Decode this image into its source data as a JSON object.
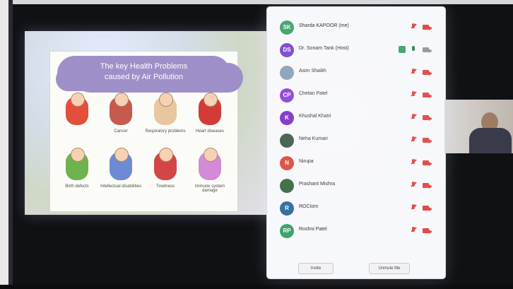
{
  "slide": {
    "title": "The key Health Problems\ncaused by Air Pollution",
    "problems": [
      {
        "label": ""
      },
      {
        "label": "Cancer"
      },
      {
        "label": "Respiratory problems"
      },
      {
        "label": "Heart diseases"
      },
      {
        "label": "Birth defects"
      },
      {
        "label": "Intellectual disabilities"
      },
      {
        "label": "Tiredness"
      },
      {
        "label": "Immune system damage"
      }
    ]
  },
  "participants": [
    {
      "initials": "SK",
      "name": "Sharda KAPOOR (me)",
      "color": "#43a36a",
      "mic": "muted",
      "cam": "off"
    },
    {
      "initials": "DS",
      "name": "Dr. Sonam Tank (Host)",
      "color": "#7c47c9",
      "mic": "on",
      "cam": "on",
      "host": true
    },
    {
      "initials": "",
      "name": "Asim Shaikh",
      "color": "#8aa0b4",
      "mic": "muted",
      "cam": "off"
    },
    {
      "initials": "CP",
      "name": "Chetan Patel",
      "color": "#8b3fd6",
      "mic": "muted",
      "cam": "off"
    },
    {
      "initials": "K",
      "name": "Khushal Khatri",
      "color": "#7b2fc1",
      "mic": "muted",
      "cam": "off"
    },
    {
      "initials": "",
      "name": "Neha Kumari",
      "color": "#3b5a48",
      "mic": "muted",
      "cam": "off"
    },
    {
      "initials": "N",
      "name": "Nirupa",
      "color": "#dc4a3e",
      "mic": "muted",
      "cam": "off"
    },
    {
      "initials": "",
      "name": "Prashant Mishra",
      "color": "#3b6b3f",
      "mic": "muted",
      "cam": "off"
    },
    {
      "initials": "R",
      "name": "ROCtom",
      "color": "#2f6e9c",
      "mic": "muted",
      "cam": "off"
    },
    {
      "initials": "RP",
      "name": "Roshni Patel",
      "color": "#3aa26b",
      "mic": "muted",
      "cam": "off"
    }
  ],
  "footer": {
    "left_button": "Invite",
    "right_button": "Unmute Me"
  }
}
